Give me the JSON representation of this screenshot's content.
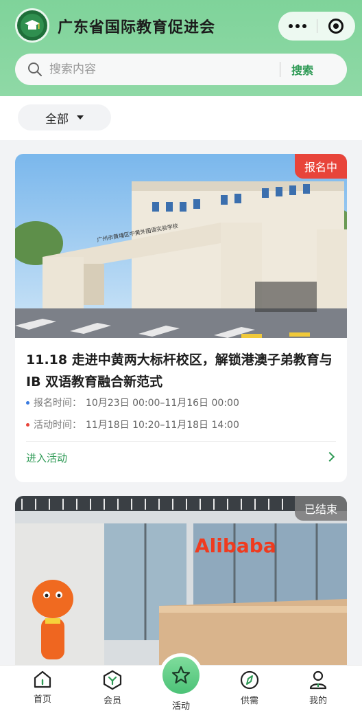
{
  "header": {
    "title": "广东省国际教育促进会",
    "logo_icon": "association-logo-icon"
  },
  "search": {
    "placeholder": "搜索内容",
    "button_label": "搜索"
  },
  "filter": {
    "selected": "全部"
  },
  "events": [
    {
      "badge": "报名中",
      "badge_color": "#e8443a",
      "title": "11.18 走进中黄两大标杆校区，解锁港澳子弟教育与 IB 双语教育融合新范式",
      "signup_label": "报名时间：",
      "signup_value": "10月23日 00:00–11月16日 00:00",
      "activity_label": "活动时间：",
      "activity_value": "11月18日 10:20–11月18日 14:00",
      "enter_label": "进入活动",
      "image_text": "广州市黄埔区中黄外国语实验学校"
    },
    {
      "badge": "已结束",
      "image_text": "Alibaba"
    }
  ],
  "tabs": [
    {
      "label": "首页",
      "icon": "home-icon"
    },
    {
      "label": "会员",
      "icon": "member-icon"
    },
    {
      "label": "活动",
      "icon": "star-icon"
    },
    {
      "label": "供需",
      "icon": "compass-icon"
    },
    {
      "label": "我的",
      "icon": "user-icon"
    }
  ],
  "colors": {
    "accent": "#2e9a55",
    "header_green": "#8fd9a6",
    "signup_dot": "#3a7be0",
    "activity_dot": "#e8443a"
  }
}
